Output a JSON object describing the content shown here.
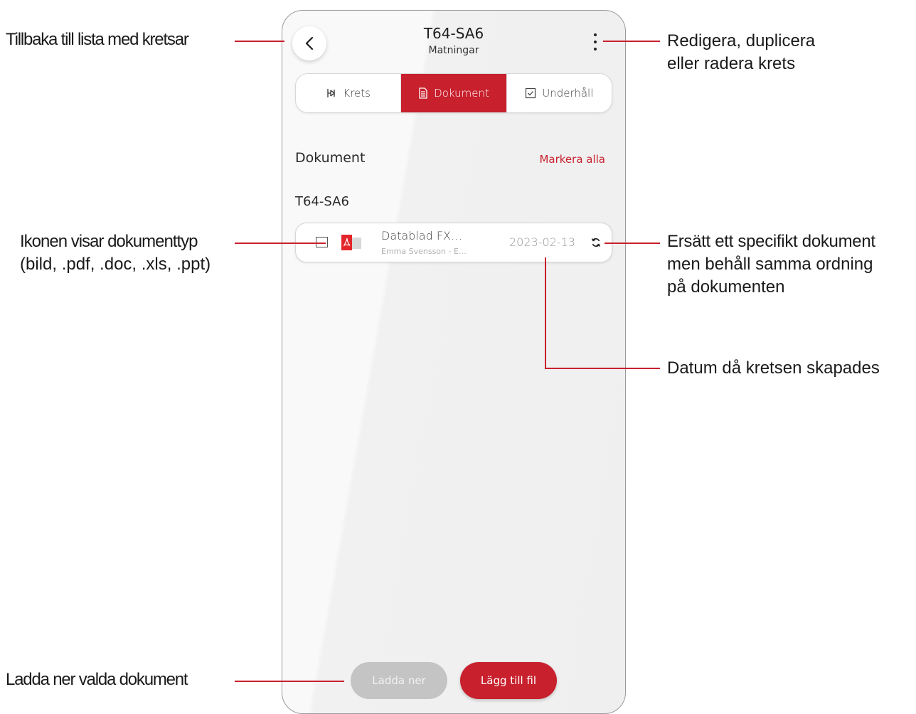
{
  "header": {
    "title": "T64-SA6",
    "subtitle": "Matningar"
  },
  "tabs": [
    {
      "label": "Krets",
      "icon": "circuit-icon",
      "active": false
    },
    {
      "label": "Dokument",
      "icon": "document-icon",
      "active": true
    },
    {
      "label": "Underhåll",
      "icon": "checkbox-icon",
      "active": false
    }
  ],
  "documents": {
    "section_title": "Dokument",
    "select_all_label": "Markera alla",
    "group_title": "T64-SA6",
    "items": [
      {
        "name": "Datablad FX…",
        "meta": "Emma Svensson - E…",
        "date": "2023-02-13",
        "type_icon": "pdf-icon"
      }
    ]
  },
  "actions": {
    "download_label": "Ladda ner",
    "add_file_label": "Lägg till fil"
  },
  "annotations": {
    "back": "Tillbaka till lista med kretsar",
    "menu_line1": "Redigera, duplicera",
    "menu_line2": "eller radera krets",
    "icon_line1": "Ikonen visar dokumenttyp",
    "icon_line2": "(bild, .pdf, .doc, .xls, .ppt)",
    "replace_line1": "Ersätt ett specifikt dokument",
    "replace_line2": "men behåll samma ordning",
    "replace_line3": "på dokumenten",
    "date": "Datum då kretsen skapades",
    "download": "Ladda ner valda dokument"
  },
  "colors": {
    "accent": "#c8202d",
    "disabled": "#c4c4c4"
  }
}
